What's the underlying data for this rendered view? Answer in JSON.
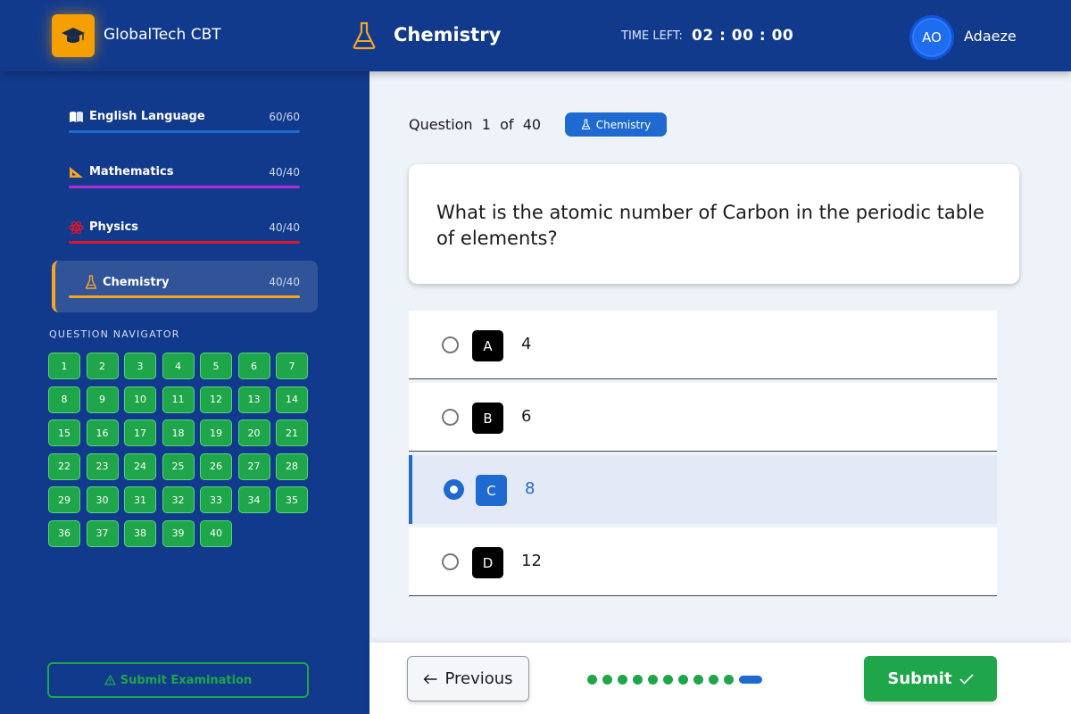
{
  "app": {
    "brand": "GlobalTech CBT",
    "logo_icon": "graduation-cap-icon"
  },
  "header": {
    "subject_title": "Chemistry",
    "subject_icon": "flask-icon",
    "time_label": "TIME LEFT:",
    "time_value": "02 : 00 : 00",
    "user_initials": "AO",
    "user_name": "Adaeze"
  },
  "sidebar": {
    "subjects": [
      {
        "icon": "book-icon",
        "label": "English Language",
        "count": "60/60",
        "color": "#1e6ad0"
      },
      {
        "icon": "ruler-icon",
        "label": "Mathematics",
        "count": "40/40",
        "color": "#b12bd6"
      },
      {
        "icon": "atom-icon",
        "label": "Physics",
        "count": "40/40",
        "color": "#e0152b"
      },
      {
        "icon": "flask-icon",
        "label": "Chemistry",
        "count": "40/40",
        "color": "#f5a623",
        "active": true
      }
    ],
    "navigator_title": "QUESTION NAVIGATOR",
    "questions": [
      "1",
      "2",
      "3",
      "4",
      "5",
      "6",
      "7",
      "8",
      "9",
      "10",
      "11",
      "12",
      "13",
      "14",
      "15",
      "16",
      "17",
      "18",
      "19",
      "20",
      "21",
      "22",
      "23",
      "24",
      "25",
      "26",
      "27",
      "28",
      "29",
      "30",
      "31",
      "32",
      "33",
      "34",
      "35",
      "36",
      "37",
      "38",
      "39",
      "40"
    ],
    "submit_exam_label": "Submit Examination",
    "submit_exam_icon": "warning-icon"
  },
  "main": {
    "counter": {
      "word": "Question",
      "current": "1",
      "of": "of",
      "total": "40"
    },
    "badge": "Chemistry",
    "question_text": "What is the atomic number of Carbon in the periodic table of elements?",
    "options": [
      {
        "letter": "A",
        "text": "4"
      },
      {
        "letter": "B",
        "text": "6"
      },
      {
        "letter": "C",
        "text": "8",
        "selected": true
      },
      {
        "letter": "D",
        "text": "12"
      }
    ]
  },
  "footer": {
    "previous_label": "Previous",
    "submit_label": "Submit",
    "progress_dots": 11,
    "current_dot": 11
  },
  "colors": {
    "primary": "#123a8c",
    "accent": "#1e6ad0",
    "success": "#1fa64a",
    "logo": "#f5a000"
  }
}
